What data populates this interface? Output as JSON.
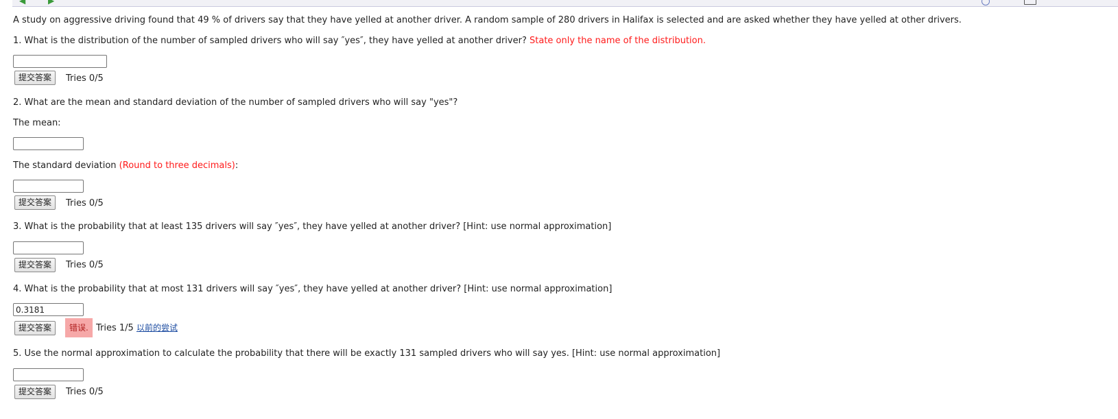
{
  "intro": "A study on aggressive driving found that 49 % of drivers say that they have yelled at another driver. A random sample of 280 drivers in Halifax is selected and are asked whether they have yelled at other drivers.",
  "submit_label": "提交答案",
  "q1": {
    "text": "1. What is the distribution of the number of sampled drivers who will say ″yes″, they have yelled at another driver?",
    "note": "State only the name of the distribution.",
    "value": "",
    "tries": "Tries 0/5"
  },
  "q2": {
    "text": "2. What are the mean and standard deviation of the number of sampled drivers who will say \"yes\"?",
    "mean_label": "The mean:",
    "mean_value": "",
    "sd_label": "The standard deviation",
    "sd_note": "(Round to three decimals)",
    "sd_colon": ":",
    "sd_value": "",
    "tries": "Tries 0/5"
  },
  "q3": {
    "text": "3. What is the probability that at least 135 drivers will say ″yes″, they have yelled at another driver? [Hint: use normal approximation]",
    "value": "",
    "tries": "Tries 0/5"
  },
  "q4": {
    "text": "4. What is the probability that at most 131 drivers will say ″yes″, they have yelled at another driver? [Hint: use normal approximation]",
    "value": "0.3181",
    "feedback": "错误.",
    "tries": "Tries 1/5",
    "prev_attempts": "以前的尝试"
  },
  "q5": {
    "text": "5. Use the normal approximation to calculate the probability that there will be exactly 131 sampled drivers who will say yes. [Hint: use normal approximation]",
    "value": "",
    "tries": "Tries 0/5"
  },
  "colors": {
    "note_red": "#ff1a1a",
    "wrong_bg": "#f6a8a8",
    "wrong_text": "#b02020",
    "link": "#1a4aa0"
  }
}
